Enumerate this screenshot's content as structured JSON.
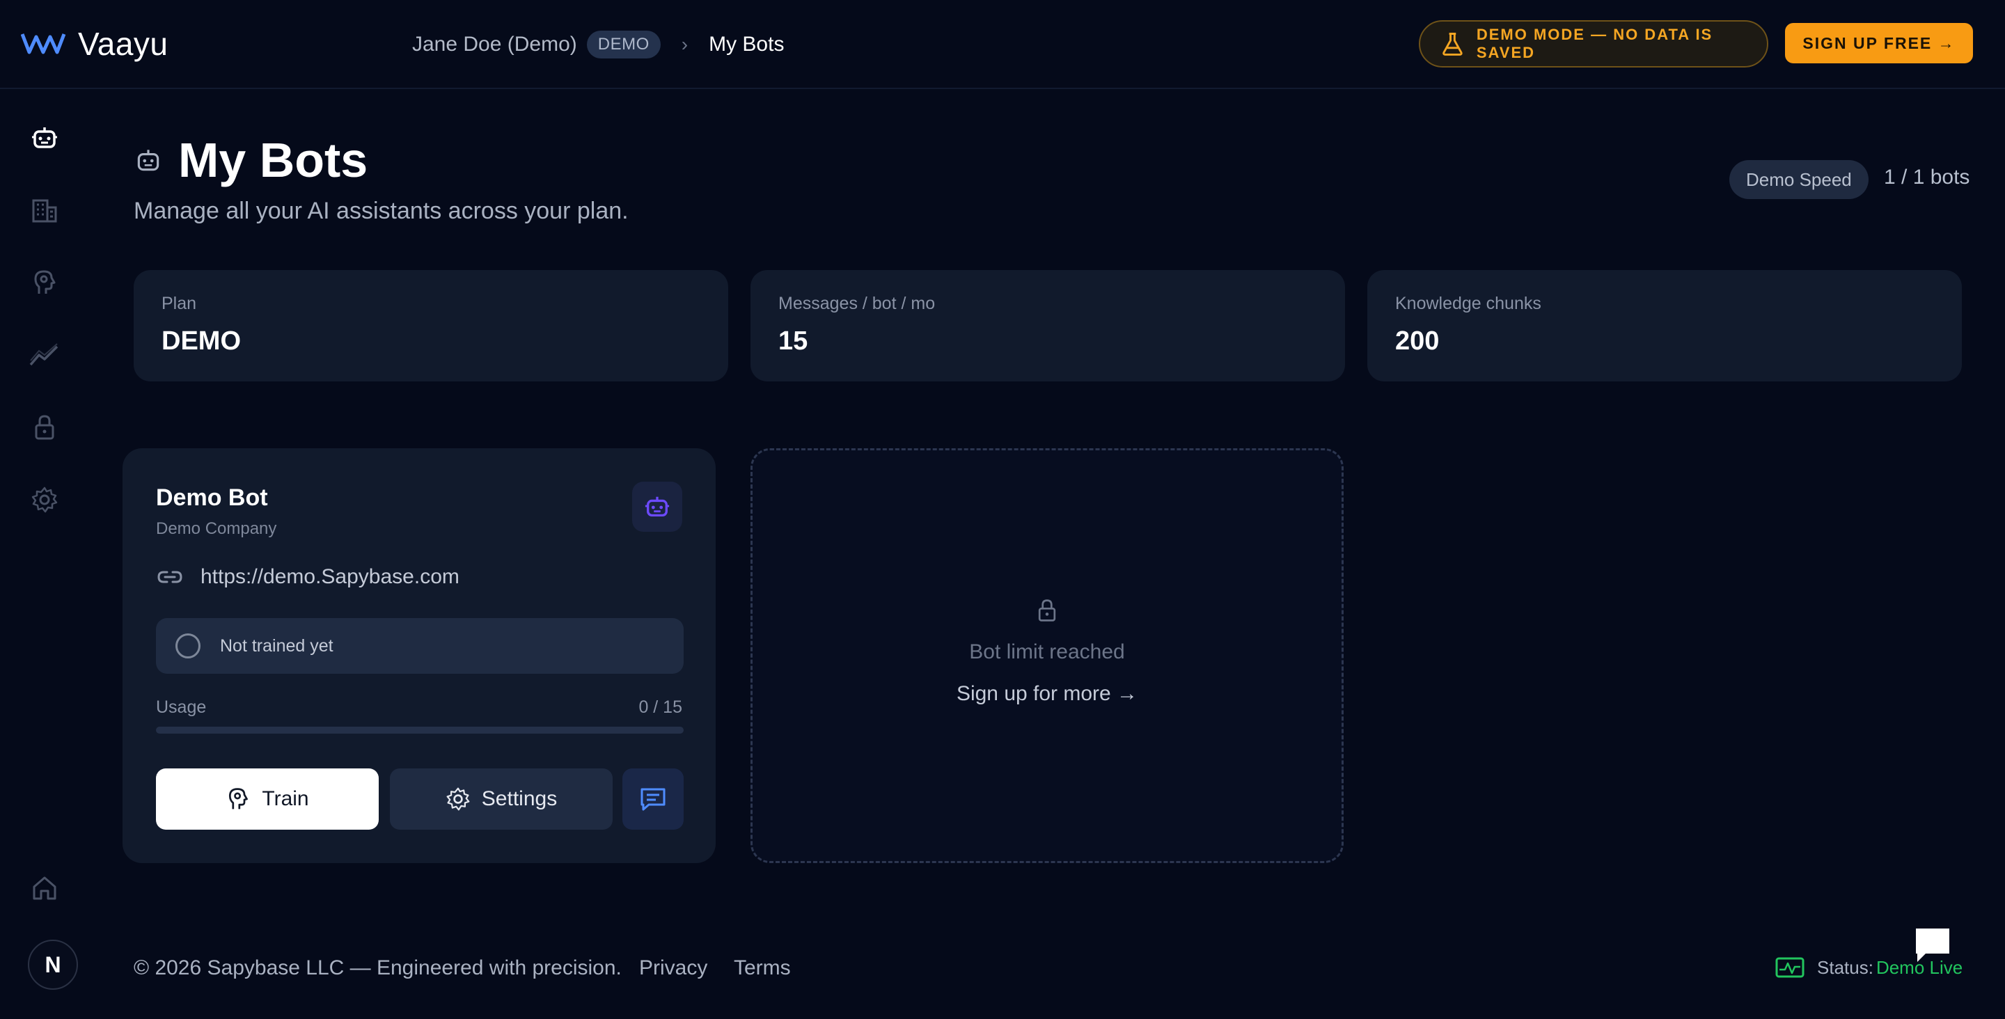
{
  "brand": {
    "name": "Vaayu"
  },
  "breadcrumb": {
    "user": "Jane Doe (Demo)",
    "badge": "DEMO",
    "page": "My Bots"
  },
  "topbar": {
    "demo_mode": "DEMO MODE — NO DATA IS SAVED",
    "signup": "SIGN UP FREE →"
  },
  "sidebar": {
    "items": [
      {
        "icon": "robot-icon",
        "active": true
      },
      {
        "icon": "building-icon"
      },
      {
        "icon": "brain-icon"
      },
      {
        "icon": "analytics-icon"
      },
      {
        "icon": "lock-icon"
      },
      {
        "icon": "gear-icon"
      }
    ],
    "home_icon": "home-icon",
    "avatar_letter": "N"
  },
  "header": {
    "title": "My Bots",
    "subtitle": "Manage all your AI assistants across your plan.",
    "speed_badge": "Demo Speed",
    "bot_count": "1 / 1 bots"
  },
  "stats": [
    {
      "label": "Plan",
      "value": "DEMO"
    },
    {
      "label": "Messages / bot / mo",
      "value": "15"
    },
    {
      "label": "Knowledge chunks",
      "value": "200"
    }
  ],
  "bot": {
    "name": "Demo Bot",
    "company": "Demo Company",
    "url": "https://demo.Sapybase.com",
    "status": "Not trained yet",
    "usage_label": "Usage",
    "usage_value": "0 / 15",
    "usage_fraction": 0,
    "train_label": "Train",
    "settings_label": "Settings"
  },
  "limit": {
    "text": "Bot limit reached",
    "link": "Sign up for more →"
  },
  "footer": {
    "copyright": "© 2026 Sapybase LLC — Engineered with precision.",
    "privacy": "Privacy",
    "terms": "Terms",
    "status_label": "Status:",
    "status_value": "Demo Live"
  },
  "colors": {
    "accent": "#f89b13",
    "background": "#050a1a",
    "card": "#111a2c",
    "status_live": "#22c55e",
    "bot_icon": "#6d4aff"
  }
}
